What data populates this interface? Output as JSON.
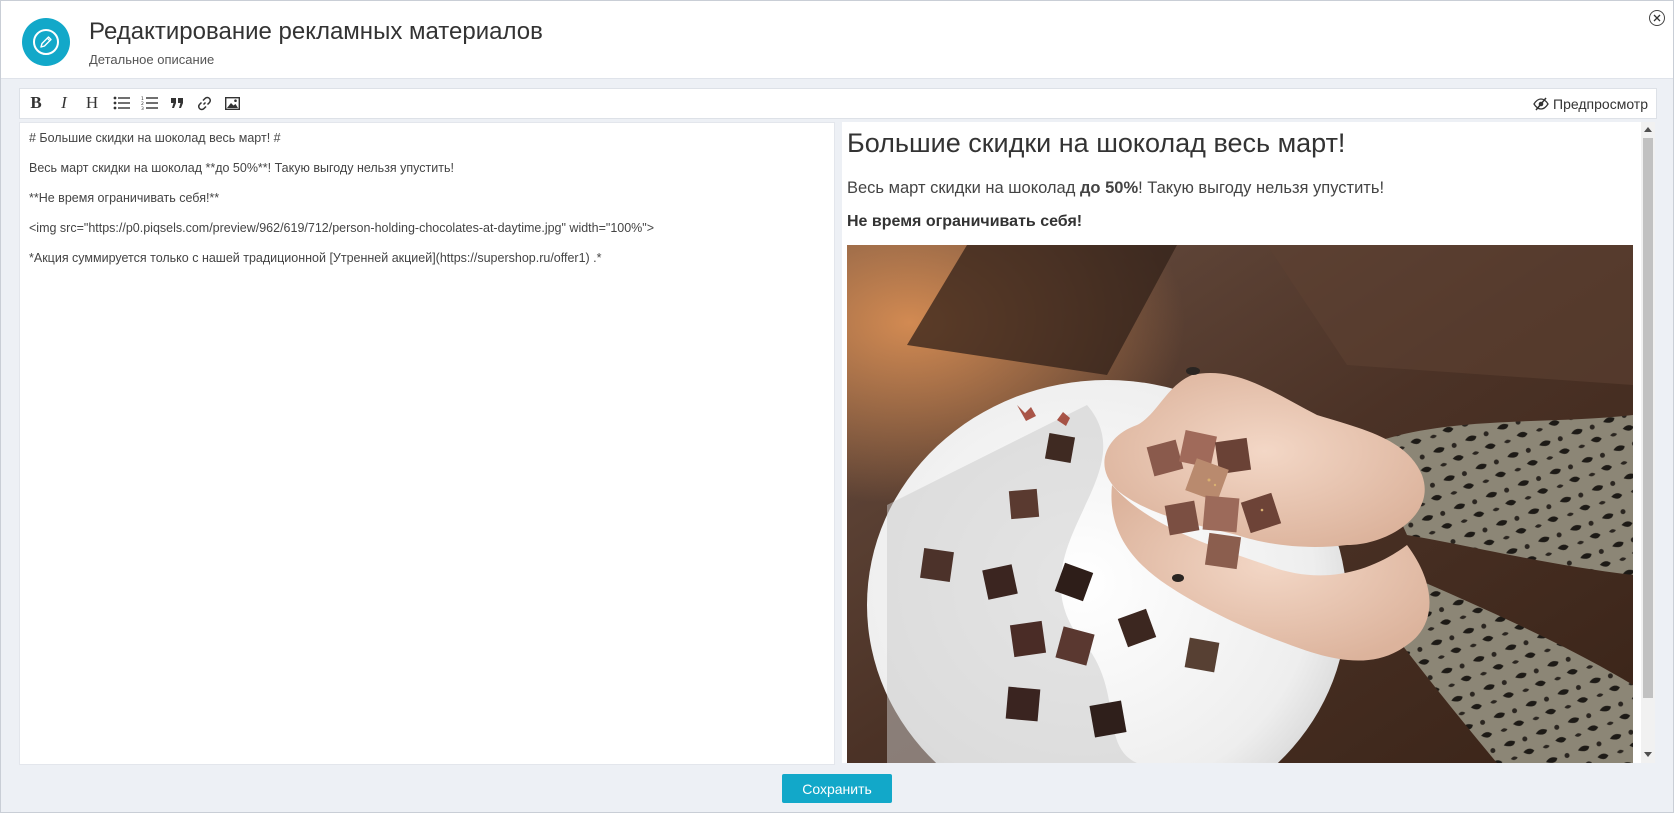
{
  "header": {
    "title": "Редактирование рекламных материалов",
    "subtitle": "Детальное описание",
    "icon": "pencil-icon",
    "accent": "#12a8c9"
  },
  "toolbar": {
    "bold_label": "B",
    "italic_label": "I",
    "heading_label": "H",
    "buttons": [
      "bold-icon",
      "italic-icon",
      "heading-icon",
      "unordered-list-icon",
      "ordered-list-icon",
      "quote-icon",
      "link-icon",
      "image-icon"
    ],
    "preview_label": "Предпросмотр",
    "preview_icon": "eye-slash-icon"
  },
  "editor": {
    "lines": [
      "# Большие скидки на шоколад весь март! #",
      "Весь март скидки на шоколад **до 50%**! Такую выгоду нельзя упустить!",
      "**Не время ограничивать себя!**",
      "<img src=\"https://p0.piqsels.com/preview/962/619/712/person-holding-chocolates-at-daytime.jpg\" width=\"100%\">",
      "*Акция суммируется только с нашей традиционной [Утренней акцией](https://supershop.ru/offer1) .*"
    ]
  },
  "preview": {
    "heading": "Большие скидки на шоколад весь март!",
    "paragraph_before": "Весь март скидки на шоколад ",
    "paragraph_bold": "до 50%",
    "paragraph_after": "! Такую выгоду нельзя упустить!",
    "strong_line": "Не время ограничивать себя!",
    "image_subject": "person-holding-chocolates-photo"
  },
  "footer": {
    "save_label": "Сохранить"
  }
}
